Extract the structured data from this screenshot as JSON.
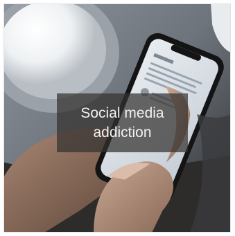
{
  "card": {
    "caption": "Social media addiction",
    "image_icon": "phone-in-hands-photo"
  },
  "colors": {
    "caption_bg": "#343230",
    "caption_text": "#f2f2f2",
    "border": "#e2e2e2"
  }
}
